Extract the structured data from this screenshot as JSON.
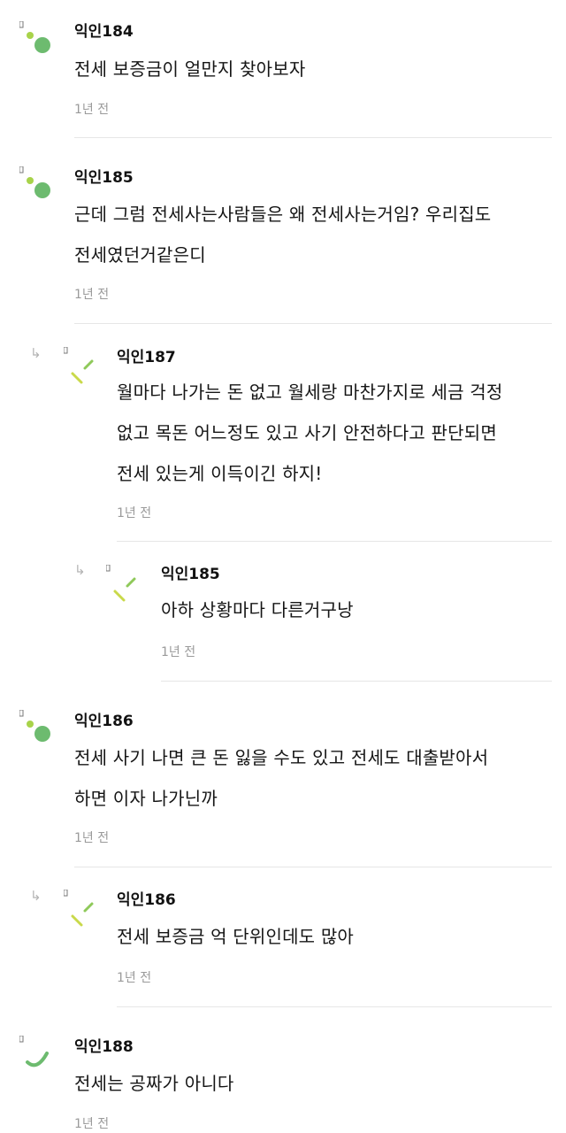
{
  "comments": [
    {
      "id": "c1",
      "author": "익인184",
      "text": "전세 보증금이 얼만지 찾아보자",
      "time": "1년 전",
      "avatar_icon": "leaf-dots-icon"
    },
    {
      "id": "c2",
      "author": "익인185",
      "text_lines": [
        "근데 그럼 전세사는사람들은 왜 전세사는거임? 우리집도",
        "전세였던거같은디"
      ],
      "time": "1년 전",
      "avatar_icon": "leaf-dots-icon"
    },
    {
      "id": "c3",
      "author": "익인187",
      "text_lines": [
        "월마다 나가는 돈 없고 월세랑 마찬가지로 세금 걱정",
        "없고 목돈 어느정도 있고 사기 안전하다고 판단되면",
        "전세 있는게 이득이긴 하지!"
      ],
      "time": "1년 전",
      "avatar_icon": "sprout-lines-icon",
      "reply_icon": "reply-arrow-icon"
    },
    {
      "id": "c4",
      "author": "익인185",
      "text": "아하 상황마다 다른거구낭",
      "time": "1년 전",
      "avatar_icon": "sprout-lines-icon",
      "reply_icon": "reply-arrow-icon"
    },
    {
      "id": "c5",
      "author": "익인186",
      "text_lines": [
        "전세 사기 나면 큰 돈 잃을 수도 있고 전세도 대출받아서",
        "하면 이자 나가닌까"
      ],
      "time": "1년 전",
      "avatar_icon": "leaf-dots-icon"
    },
    {
      "id": "c6",
      "author": "익인186",
      "text": "전세 보증금 억 단위인데도 많아",
      "time": "1년 전",
      "avatar_icon": "sprout-lines-icon",
      "reply_icon": "reply-arrow-icon"
    },
    {
      "id": "c7",
      "author": "익인188",
      "text": "전세는 공짜가 아니다",
      "time": "1년 전",
      "avatar_icon": "arc-icon"
    }
  ],
  "colors": {
    "avatar_green": "#6dbb6f",
    "avatar_light_green": "#a8d34a",
    "avatar_yellow": "#c9d94a"
  }
}
